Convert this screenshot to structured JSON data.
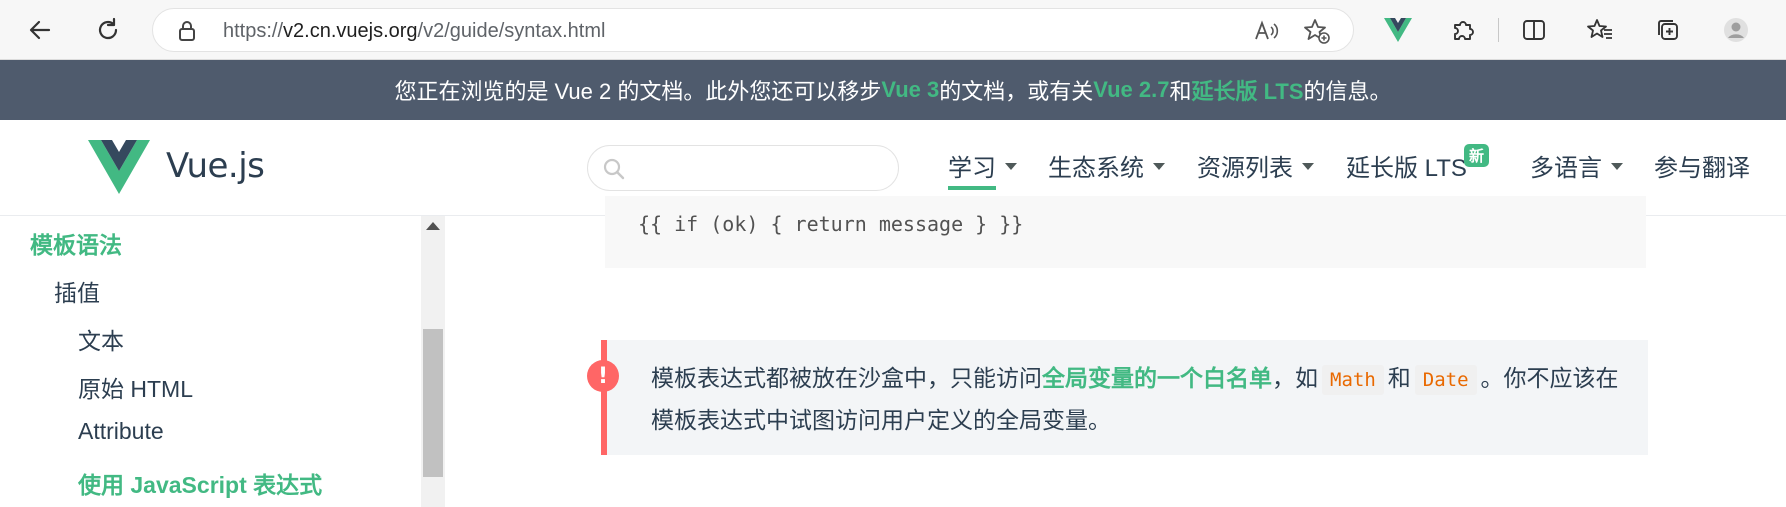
{
  "browser": {
    "url_prefix": "https://",
    "url_host": "v2.cn.vuejs.org",
    "url_path": "/v2/guide/syntax.html"
  },
  "banner": {
    "part1": "您正在浏览的是 Vue 2 的文档。此外您还可以移步 ",
    "link1": "Vue 3",
    "part2": " 的文档，或有关 ",
    "link2": "Vue 2.7",
    "part3": " 和 ",
    "link3": "延长版 LTS",
    "part4": " 的信息。"
  },
  "header": {
    "logo_text": "Vue.js",
    "nav": {
      "learn": "学习",
      "ecosystem": "生态系统",
      "resources": "资源列表",
      "lts": "延长版 LTS",
      "lts_badge": "新",
      "languages": "多语言",
      "translate": "参与翻译"
    }
  },
  "sidebar": {
    "section": "模板语法",
    "interpolation": "插值",
    "text": "文本",
    "raw_html": "原始 HTML",
    "attribute": "Attribute",
    "js_expr": "使用 JavaScript 表达式"
  },
  "content": {
    "code_line": "{{ if (ok) { return message } }}",
    "tip_icon": "!",
    "tip_part1": "模板表达式都被放在沙盒中，只能访问",
    "tip_link": "全局变量的一个白名单",
    "tip_part2": "，如",
    "tip_code1": "Math",
    "tip_part3": "和",
    "tip_code2": "Date",
    "tip_part4": "。你不应该在模板表达式中试图访问用户定义的全局变量。"
  },
  "colors": {
    "accent": "#42b983",
    "banner_bg": "#4f5b6d",
    "warning": "#ff6666"
  }
}
